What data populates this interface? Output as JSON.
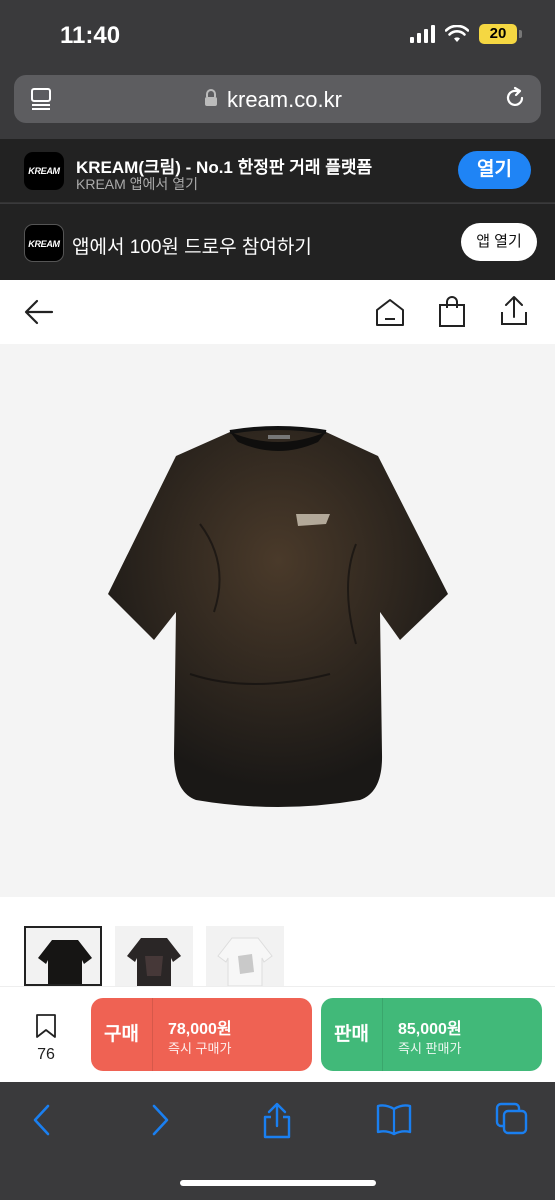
{
  "status_bar": {
    "time": "11:40",
    "battery": "20"
  },
  "browser": {
    "url": "kream.co.kr"
  },
  "banner": {
    "logo_text": "KREAM",
    "title": "KREAM(크림) - No.1 한정판 거래 플랫폼",
    "subtitle": "KREAM 앱에서 열기",
    "open_label": "열기"
  },
  "promo": {
    "logo_text": "KREAM",
    "title": "앱에서 100원 드로우 참여하기",
    "open_app_label": "앱 열기"
  },
  "product": {
    "bookmark_count": "76",
    "buy": {
      "label": "구매",
      "price": "78,000원",
      "sub": "즉시 구매가"
    },
    "sell": {
      "label": "판매",
      "price": "85,000원",
      "sub": "즉시 판매가"
    }
  },
  "colors": {
    "buy": "#ef6253",
    "sell": "#41b979",
    "open_button": "#1f84f5"
  }
}
